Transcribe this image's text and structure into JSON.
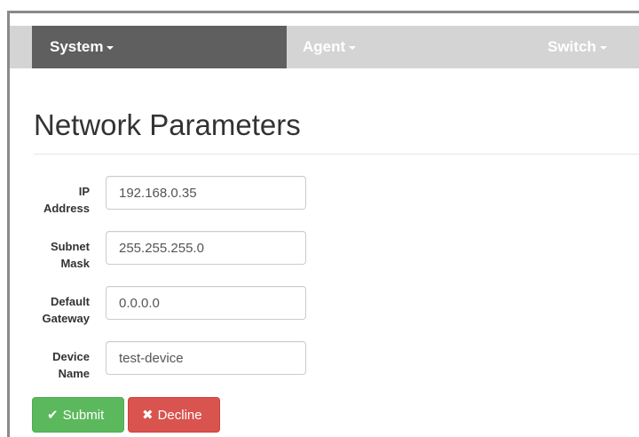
{
  "nav": {
    "system": "System",
    "agent": "Agent",
    "switch": "Switch"
  },
  "page": {
    "title": "Network Parameters"
  },
  "form": {
    "ip_label_1": "IP",
    "ip_label_2": "Address",
    "ip_value": "192.168.0.35",
    "subnet_label_1": "Subnet",
    "subnet_label_2": "Mask",
    "subnet_value": "255.255.255.0",
    "gateway_label_1": "Default",
    "gateway_label_2": "Gateway",
    "gateway_value": "0.0.0.0",
    "device_label_1": "Device",
    "device_label_2": "Name",
    "device_value": "test-device"
  },
  "buttons": {
    "submit": "Submit",
    "decline": "Decline",
    "submit_icon": "check-icon",
    "decline_icon": "times-icon"
  },
  "colors": {
    "nav_bg": "#d4d4d4",
    "nav_active": "#5f5f5f",
    "submit": "#5cb85c",
    "decline": "#d9534f"
  }
}
